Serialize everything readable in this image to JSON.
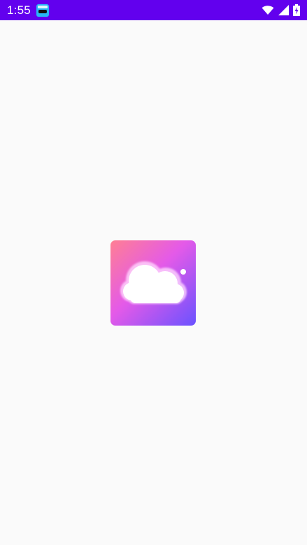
{
  "status_bar": {
    "time": "1:55",
    "background": "#6200ee",
    "icons": [
      "app-notification-icon",
      "wifi-icon",
      "cellular-signal-icon",
      "battery-charging-icon"
    ]
  },
  "screen": {
    "type": "splash",
    "background": "#fafafa",
    "logo_icon": "cloud-icon",
    "logo_gradient": [
      "#ff7f93",
      "#e45ae8",
      "#6a52ff"
    ]
  }
}
